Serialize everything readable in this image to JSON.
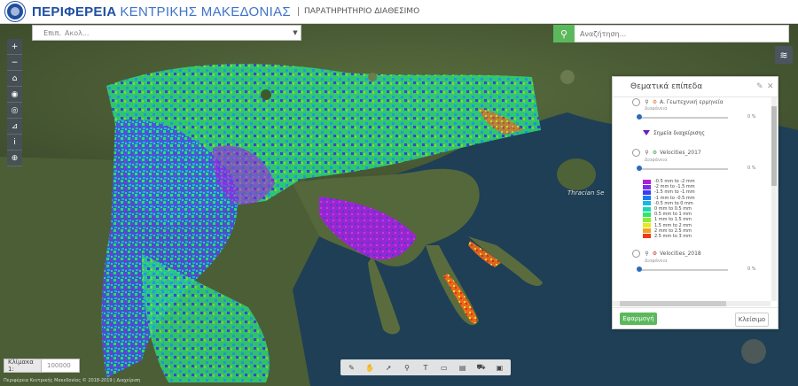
{
  "header": {
    "title_part1": "ΠΕΡΙΦΕΡΕΙΑ",
    "title_part2": "ΚΕΝΤΡΙΚΗΣ ΜΑΚΕΔΟΝΙΑΣ",
    "subtitle": "ΠΑΡΑΤΗΡΗΤΗΡΙΟ ΔΙΑΘΕΣΙΜΟ"
  },
  "layer_select": {
    "label": "Επιπ.",
    "value": "Ακολ..."
  },
  "search": {
    "button_icon": "search-icon",
    "placeholder": "Αναζήτηση..."
  },
  "toolbar": {
    "items": [
      {
        "name": "zoom-in-icon",
        "glyph": "+"
      },
      {
        "name": "zoom-out-icon",
        "glyph": "−"
      },
      {
        "name": "home-icon",
        "glyph": "⌂"
      },
      {
        "name": "location-icon",
        "glyph": "◉"
      },
      {
        "name": "eye-icon",
        "glyph": "◎"
      },
      {
        "name": "measure-icon",
        "glyph": "⊿"
      },
      {
        "name": "info-icon",
        "glyph": "i"
      },
      {
        "name": "zoom-box-icon",
        "glyph": "⊕"
      }
    ]
  },
  "layers_button": {
    "icon": "layers-icon"
  },
  "panel": {
    "title": "Θεματικά επίπεδα",
    "layer1": {
      "name": "Α. Γεωτεχνική ερμηνεία",
      "sub": "Διαφάνεια",
      "opacity": 0
    },
    "point_legend": "Σημεία διαχείρισης",
    "layer2": {
      "name": "Velocities_2017",
      "sub": "Διαφάνεια",
      "opacity": 0
    },
    "legend": [
      {
        "label": "-0.5 mm to -2 mm",
        "color": "#b01fd8"
      },
      {
        "label": "-2 mm to -1.5 mm",
        "color": "#7a2cf0"
      },
      {
        "label": "-1.5 mm to -1 mm",
        "color": "#3a3cf5"
      },
      {
        "label": "-1 mm to -0.5 mm",
        "color": "#1a7af0"
      },
      {
        "label": "-0.5 mm to 0 mm",
        "color": "#15b8e8"
      },
      {
        "label": "0 mm to 0.5 mm",
        "color": "#19d8b0"
      },
      {
        "label": "0.5 mm to 1 mm",
        "color": "#2ae86a"
      },
      {
        "label": "1 mm to 1.5 mm",
        "color": "#8cef2a"
      },
      {
        "label": "1.5 mm to 2 mm",
        "color": "#e8e822"
      },
      {
        "label": "2 mm to 2.5 mm",
        "color": "#f5a21a"
      },
      {
        "label": "2.5 mm to 3 mm",
        "color": "#ef3a1a"
      }
    ],
    "layer3": {
      "name": "Velocities_2018",
      "sub": "Διαφάνεια",
      "opacity": 0
    },
    "apply_label": "Εφαρμογή",
    "close_label": "Κλείσιμο"
  },
  "scale": {
    "label": "Κλίμακα 1:",
    "value": "100000"
  },
  "copyright": "Περιφέρεια Κεντρικής Μακεδονίας © 2018-2019 | Διαχείριση",
  "map_labels": {
    "thracian": "Thracian Se"
  },
  "bottom_tools": [
    {
      "name": "pencil-icon",
      "glyph": "✎"
    },
    {
      "name": "hand-icon",
      "glyph": "✋"
    },
    {
      "name": "arrow-icon",
      "glyph": "➚"
    },
    {
      "name": "marker-icon",
      "glyph": "⚲"
    },
    {
      "name": "text-icon",
      "glyph": "T"
    },
    {
      "name": "rectangle-icon",
      "glyph": "▭"
    },
    {
      "name": "print-icon",
      "glyph": "▤"
    },
    {
      "name": "car-icon",
      "glyph": "⛟"
    },
    {
      "name": "save-icon",
      "glyph": "▣"
    }
  ]
}
